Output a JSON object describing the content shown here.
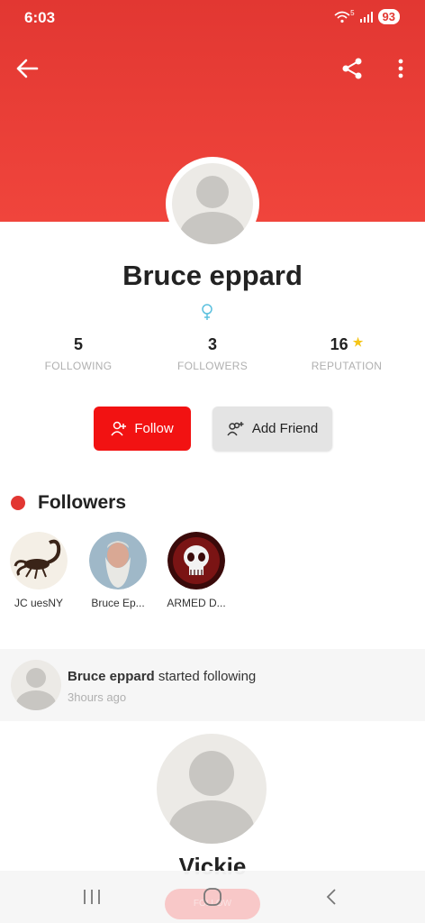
{
  "status_bar": {
    "time": "6:03",
    "battery": "93",
    "network": "5"
  },
  "profile": {
    "name": "Bruce eppard",
    "gender_icon": "female-symbol-icon"
  },
  "stats": [
    {
      "value": "5",
      "label": "FOLLOWING"
    },
    {
      "value": "3",
      "label": "FOLLOWERS"
    },
    {
      "value": "16",
      "label": "REPUTATION"
    }
  ],
  "actions": {
    "follow_label": "Follow",
    "add_friend_label": "Add Friend"
  },
  "followers_section": {
    "title": "Followers",
    "items": [
      {
        "name": "JC  uesNY"
      },
      {
        "name": "Bruce Ep..."
      },
      {
        "name": "ARMED D..."
      }
    ]
  },
  "activity": {
    "actor": "Bruce eppard",
    "action": " started following",
    "time": "3hours ago"
  },
  "suggestion": {
    "name": "Vickie",
    "button_label": "FOLLOW"
  },
  "colors": {
    "header": "#e23732",
    "follow_button": "#f21212",
    "star": "#f5c518",
    "gender": "#5bc0de"
  }
}
